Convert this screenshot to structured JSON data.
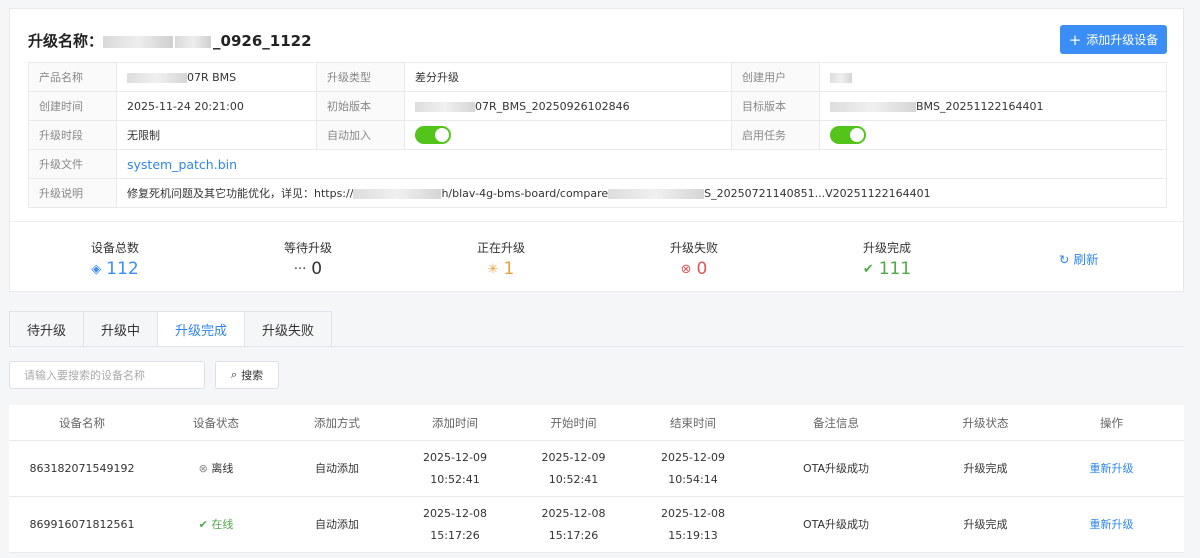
{
  "header": {
    "title_prefix": "升级名称：",
    "title_suffix": "_0926_1122",
    "add_button": "添加升级设备"
  },
  "info": {
    "product_label": "产品名称",
    "product_value": "07R BMS",
    "type_label": "升级类型",
    "type_value": "差分升级",
    "creator_label": "创建用户",
    "created_label": "创建时间",
    "created_value": "2025-11-24 20:21:00",
    "init_label": "初始版本",
    "init_value": "07R_BMS_20250926102846",
    "target_label": "目标版本",
    "target_value": "BMS_20251122164401",
    "period_label": "升级时段",
    "period_value": "无限制",
    "auto_label": "自动加入",
    "enable_label": "启用任务",
    "file_label": "升级文件",
    "file_value": "system_patch.bin",
    "desc_label": "升级说明",
    "desc_a": "修复死机问题及其它功能优化，详见：https://",
    "desc_b": "h/blav-4g-bms-board/compare",
    "desc_c": "S_20250721140851...V20251122164401"
  },
  "stats": [
    {
      "label": "设备总数",
      "value": "112",
      "color": "#3a8ef6",
      "icon": "total-icon"
    },
    {
      "label": "等待升级",
      "value": "0",
      "color": "#333333",
      "icon": "waiting-icon"
    },
    {
      "label": "正在升级",
      "value": "1",
      "color": "#e6a23c",
      "icon": "upgrading-icon"
    },
    {
      "label": "升级失败",
      "value": "0",
      "color": "#e05656",
      "icon": "failed-icon"
    },
    {
      "label": "升级完成",
      "value": "111",
      "color": "#52a84b",
      "icon": "completed-icon"
    }
  ],
  "refresh_label": "刷新",
  "tabs": [
    "待升级",
    "升级中",
    "升级完成",
    "升级失败"
  ],
  "search": {
    "placeholder": "请输入要搜索的设备名称",
    "button": "搜索"
  },
  "table": {
    "headers": [
      "设备名称",
      "设备状态",
      "添加方式",
      "添加时间",
      "开始时间",
      "结束时间",
      "备注信息",
      "升级状态",
      "操作"
    ],
    "rows": [
      {
        "name": "863182071549192",
        "status": "离线",
        "method": "自动添加",
        "add_date": "2025-12-09",
        "add_time": "10:52:41",
        "start_date": "2025-12-09",
        "start_time": "10:52:41",
        "end_date": "2025-12-09",
        "end_time": "10:54:14",
        "note": "OTA升级成功",
        "state": "升级完成",
        "op": "重新升级"
      },
      {
        "name": "869916071812561",
        "status": "在线",
        "method": "自动添加",
        "add_date": "2025-12-08",
        "add_time": "15:17:26",
        "start_date": "2025-12-08",
        "start_time": "15:17:26",
        "end_date": "2025-12-08",
        "end_time": "15:19:13",
        "note": "OTA升级成功",
        "state": "升级完成",
        "op": "重新升级"
      }
    ]
  }
}
